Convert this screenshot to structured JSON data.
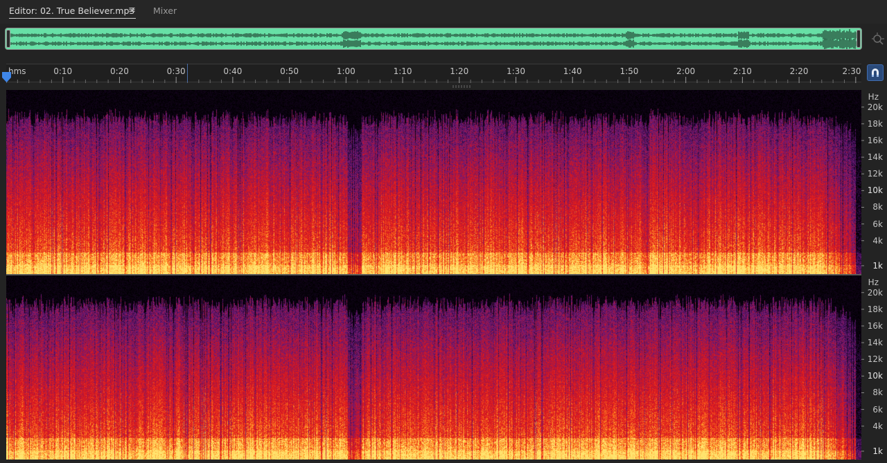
{
  "tabs": {
    "editor_label": "Editor: 02. True Believer.mp3",
    "menu_glyph": "≡",
    "mixer_label": "Mixer"
  },
  "icons": {
    "tab_menu": "hamburger-menu-icon",
    "zoom": "zoom-navigator-icon",
    "snap": "magnet-icon",
    "playhead": "playhead-marker-icon"
  },
  "colors": {
    "overview_waveform_bg": "#67e0a6",
    "overview_waveform_ink": "#1d3a2c",
    "accent": "#3f6db0",
    "spectral_low": "#ffe066",
    "spectral_mid": "#e8241c",
    "spectral_high": "#6a1a7a"
  },
  "timeline": {
    "unit": "hms",
    "labels": [
      "0:10",
      "0:20",
      "0:30",
      "0:40",
      "0:50",
      "1:00",
      "1:10",
      "1:20",
      "1:30",
      "1:40",
      "1:50",
      "2:00",
      "2:10",
      "2:20",
      "2:30"
    ],
    "duration_seconds": 151
  },
  "hz_scale": {
    "unit": "Hz",
    "labels": [
      "20k",
      "18k",
      "16k",
      "14k",
      "12k",
      "10k",
      "8k",
      "6k",
      "4k",
      "1k"
    ],
    "values": [
      20000,
      18000,
      16000,
      14000,
      12000,
      10000,
      8000,
      6000,
      4000,
      1000
    ],
    "bold": [
      "10k",
      "1k"
    ],
    "max": 22050
  },
  "channels": [
    "left",
    "right"
  ]
}
